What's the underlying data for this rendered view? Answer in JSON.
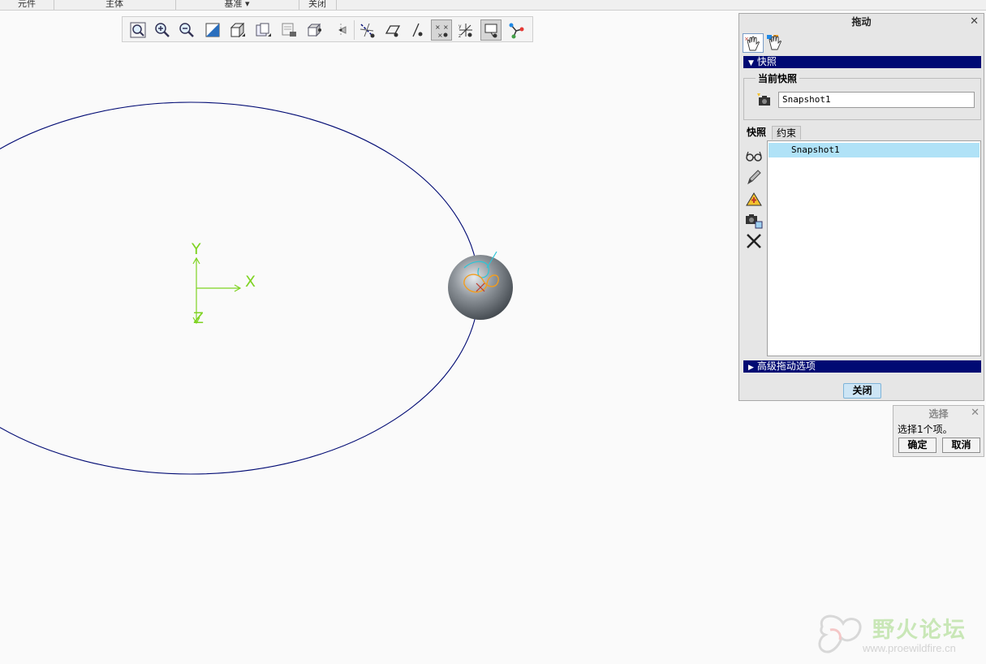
{
  "ribbon": {
    "groups": [
      "元件",
      "主体",
      "基准 ▾",
      "关闭"
    ]
  },
  "toolbar": {
    "buttons": [
      {
        "icon": "zoom-fit-icon"
      },
      {
        "icon": "zoom-in-icon"
      },
      {
        "icon": "zoom-out-icon"
      },
      {
        "icon": "refit-icon"
      },
      {
        "icon": "display-style-icon"
      },
      {
        "icon": "saved-views-icon"
      },
      {
        "icon": "view-manager-icon"
      },
      {
        "icon": "perspective-icon"
      },
      {
        "icon": "spin-center-icon"
      },
      {
        "icon": "datum-axis-icon"
      },
      {
        "icon": "datum-plane-icon"
      },
      {
        "icon": "datum-point-icon"
      },
      {
        "icon": "datum-coordinate-icon"
      },
      {
        "icon": "datum-csys-icon"
      },
      {
        "icon": "annotation-display-icon"
      },
      {
        "icon": "joint-connection-icon"
      }
    ]
  },
  "canvas": {
    "axis_labels": {
      "y": "Y",
      "x": "X",
      "z": "Z"
    },
    "orbit_color": "#000a73",
    "sphere_color": "#8e949a",
    "axis_color": "#7ed321"
  },
  "drag_dialog": {
    "title": "拖动",
    "close_glyph": "✕",
    "snapshot_section": "快照",
    "current_snapshot_label": "当前快照",
    "current_snapshot_value": "Snapshot1",
    "tabs": [
      "快照",
      "约束"
    ],
    "snapshot_list": [
      "Snapshot1"
    ],
    "advanced_section": "高级拖动选项",
    "close_button": "关闭"
  },
  "select_dialog": {
    "title": "选择",
    "close_glyph": "✕",
    "message": "选择1个项。",
    "ok": "确定",
    "cancel": "取消"
  },
  "watermark": {
    "name": "野火论坛",
    "url": "www.proewildfire.cn"
  },
  "annotation": {
    "arrow_color": "#e53935"
  }
}
